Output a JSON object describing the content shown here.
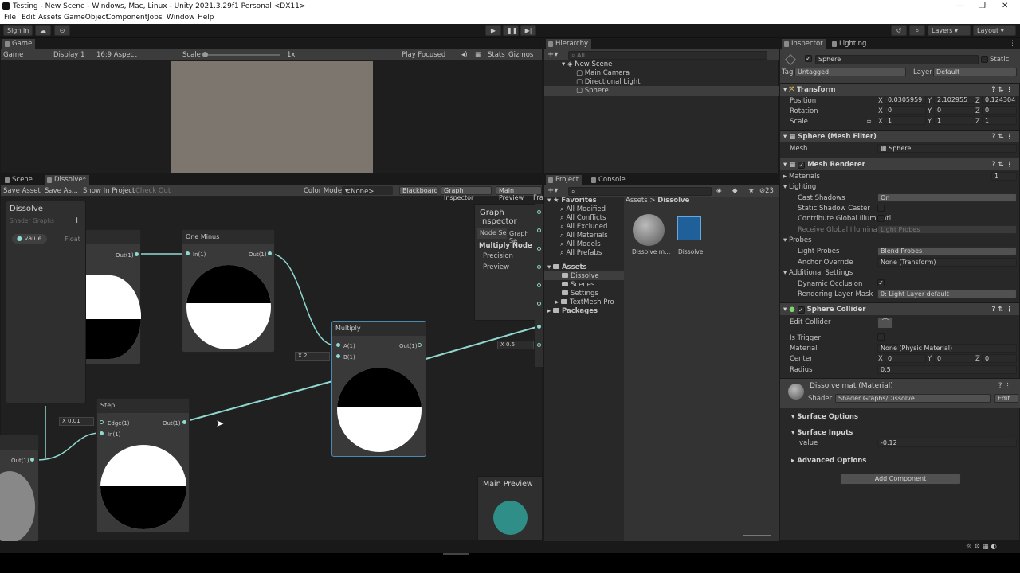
{
  "window": {
    "title": "Testing - New Scene - Windows, Mac, Linux - Unity 2021.3.29f1 Personal <DX11>",
    "minimize": "—",
    "maximize": "❐",
    "close": "✕"
  },
  "menu": [
    "File",
    "Edit",
    "Assets",
    "GameObject",
    "Component",
    "Jobs",
    "Window",
    "Help"
  ],
  "toolbar": {
    "sign_in": "Sign in",
    "layers": "Layers",
    "layout": "Layout"
  },
  "game": {
    "tab": "Game",
    "display_mode": "Game",
    "display": "Display 1",
    "aspect": "16:9 Aspect",
    "scale_label": "Scale",
    "scale_value": "1x",
    "play_focused": "Play Focused",
    "stats": "Stats",
    "gizmos": "Gizmos"
  },
  "graph": {
    "tab_scene": "Scene",
    "tab_dissolve": "Dissolve*",
    "save_asset": "Save Asset",
    "save_as": "Save As...",
    "show_in_project": "Show In Project",
    "check_out": "Check Out",
    "color_mode_label": "Color Mode",
    "color_mode_value": "<None>",
    "blackboard": "Blackboard",
    "graph_inspector": "Graph Inspector",
    "main_preview": "Main Preview",
    "blackboard_panel": {
      "title": "Dissolve",
      "subtitle": "Shader Graphs",
      "add": "+",
      "prop_name": "value",
      "prop_type": "Float"
    },
    "one_minus": {
      "title": "One Minus",
      "in": "In(1)",
      "out": "Out(1)"
    },
    "left_node": {
      "out": "Out(1)"
    },
    "multiply": {
      "title": "Multiply",
      "a": "A(1)",
      "b": "B(1)",
      "out": "Out(1)",
      "b_x_label": "X",
      "b_value": "2"
    },
    "step": {
      "title": "Step",
      "edge": "Edge(1)",
      "in": "In(1)",
      "out": "Out(1)",
      "edge_x_label": "X",
      "edge_value": "0.01"
    },
    "bottom_left": {
      "out": "Out(1)"
    },
    "right_input": {
      "x_label": "X",
      "value": "0.5"
    },
    "graph_inspector_panel": {
      "title": "Graph Inspector",
      "tab_node": "Node Se",
      "tab_graph": "Graph Se",
      "heading": "Multiply Node",
      "precision": "Precision",
      "preview": "Preview"
    },
    "main_preview_panel": {
      "title": "Main Preview"
    },
    "fr": "Fra"
  },
  "hierarchy": {
    "tab": "Hierarchy",
    "search": "All",
    "items": [
      "New Scene",
      "Main Camera",
      "Directional Light",
      "Sphere"
    ]
  },
  "project": {
    "tab_project": "Project",
    "tab_console": "Console",
    "count": "23",
    "favorites": "Favorites",
    "fav_items": [
      "All Modified",
      "All Conflicts",
      "All Excluded",
      "All Materials",
      "All Models",
      "All Prefabs"
    ],
    "assets": "Assets",
    "asset_items": [
      "Dissolve",
      "Scenes",
      "Settings",
      "TextMesh Pro"
    ],
    "packages": "Packages",
    "breadcrumb_root": "Assets",
    "breadcrumb_sep": ">",
    "breadcrumb_leaf": "Dissolve",
    "files": [
      "Dissolve m...",
      "Dissolve"
    ]
  },
  "inspector": {
    "tab_inspector": "Inspector",
    "tab_lighting": "Lighting",
    "object_name": "Sphere",
    "static": "Static",
    "tag_label": "Tag",
    "tag_value": "Untagged",
    "layer_label": "Layer",
    "layer_value": "Default",
    "transform": {
      "title": "Transform",
      "position": {
        "label": "Position",
        "x": "0.0305959",
        "y": "2.102955",
        "z": "0.124304"
      },
      "rotation": {
        "label": "Rotation",
        "x": "0",
        "y": "0",
        "z": "0"
      },
      "scale": {
        "label": "Scale",
        "x": "1",
        "y": "1",
        "z": "1"
      }
    },
    "mesh_filter": {
      "title": "Sphere (Mesh Filter)",
      "mesh_label": "Mesh",
      "mesh_value": "Sphere"
    },
    "mesh_renderer": {
      "title": "Mesh Renderer",
      "materials": "Materials",
      "materials_count": "1",
      "lighting": "Lighting",
      "cast_shadows": "Cast Shadows",
      "cast_shadows_value": "On",
      "static_shadow": "Static Shadow Caster",
      "contribute_gi": "Contribute Global Illuminati",
      "receive_gi": "Receive Global Illuminatio",
      "receive_gi_value": "Light Probes",
      "probes": "Probes",
      "light_probes": "Light Probes",
      "light_probes_value": "Blend Probes",
      "anchor_override": "Anchor Override",
      "anchor_value": "None (Transform)",
      "additional": "Additional Settings",
      "dynamic_occlusion": "Dynamic Occlusion",
      "rendering_layer": "Rendering Layer Mask",
      "rendering_layer_value": "0: Light Layer default"
    },
    "sphere_collider": {
      "title": "Sphere Collider",
      "edit_collider": "Edit Collider",
      "is_trigger": "Is Trigger",
      "material": "Material",
      "material_value": "None (Physic Material)",
      "center": "Center",
      "cx": "0",
      "cy": "0",
      "cz": "0",
      "radius": "Radius",
      "radius_value": "0.5"
    },
    "material": {
      "title": "Dissolve mat (Material)",
      "shader_label": "Shader",
      "shader_value": "Shader Graphs/Dissolve",
      "edit": "Edit...",
      "surface_options": "Surface Options",
      "surface_inputs": "Surface Inputs",
      "value_label": "value",
      "value": "-0.12",
      "advanced": "Advanced Options"
    },
    "add_component": "Add Component"
  },
  "colors": {
    "accent": "#8fd9d0",
    "selected": "#2c5d87",
    "preview_teal": "#2f8f88",
    "game_view": "#7d766f"
  }
}
